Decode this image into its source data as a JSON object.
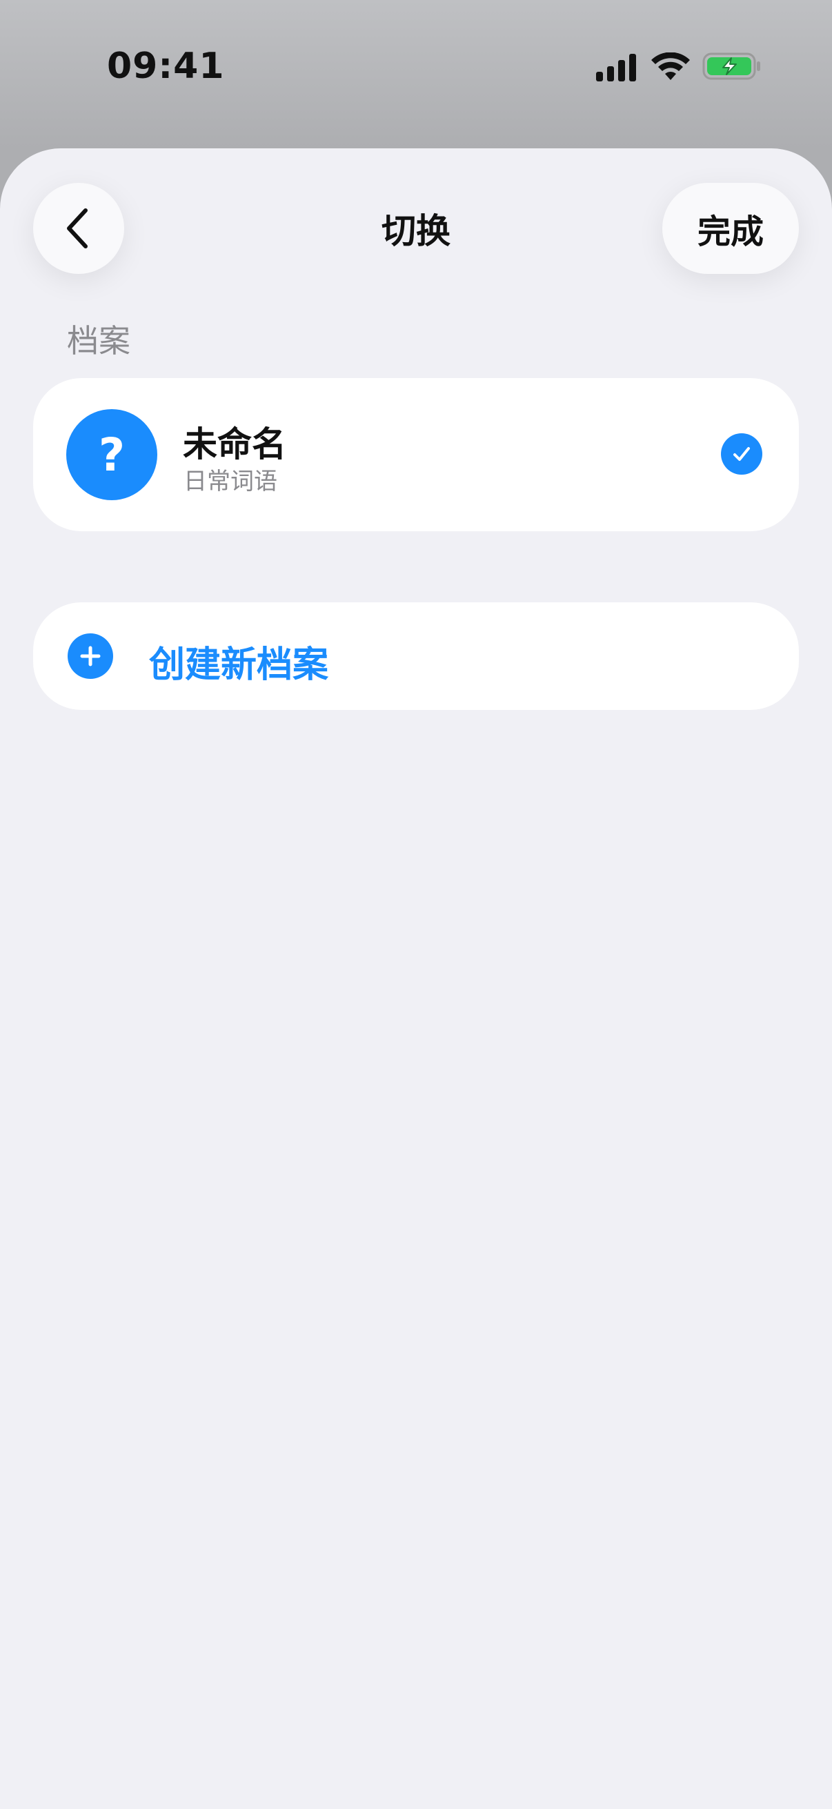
{
  "status_bar": {
    "time": "09:41",
    "icons": [
      "cellular-signal-icon",
      "wifi-icon",
      "battery-charging-icon"
    ]
  },
  "nav": {
    "back_icon": "chevron-left-icon",
    "title": "切换",
    "done_label": "完成"
  },
  "section": {
    "header": "档案"
  },
  "profile": {
    "avatar_symbol": "?",
    "name": "未命名",
    "subtitle": "日常词语",
    "selected": true,
    "selected_icon": "checkmark-circle-icon"
  },
  "create": {
    "icon": "plus-circle-icon",
    "label": "创建新档案"
  },
  "colors": {
    "accent": "#1a8cfd",
    "background": "#f0f0f5",
    "card": "#ffffff",
    "secondary_text": "#8a8a8e",
    "battery_green": "#34c759"
  }
}
